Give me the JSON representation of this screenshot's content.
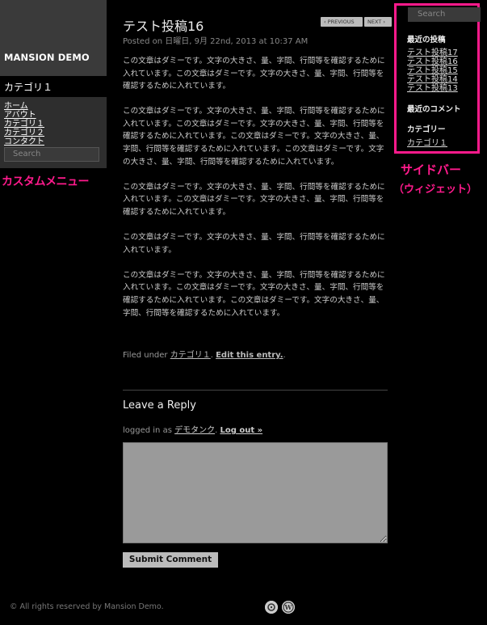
{
  "site": {
    "title": "MANSION DEMO"
  },
  "left": {
    "category_heading": "カテゴリ１",
    "menu": [
      "ホーム",
      "アバウト",
      "カテゴリ１",
      "カテゴリ２",
      "コンタクト"
    ],
    "search_placeholder": "Search",
    "annotation": "カスタムメニュー"
  },
  "post": {
    "title": "テスト投稿16",
    "meta": "Posted on 日曜日, 9月 22nd, 2013 at 10:37 AM",
    "nav": {
      "prev": "‹ PREVIOUS",
      "next": "NEXT ›"
    },
    "paragraphs": [
      "この文章はダミーです。文字の大きさ、量、字間、行間等を確認するために入れています。この文章はダミーです。文字の大きさ、量、字間、行間等を確認するために入れています。",
      "この文章はダミーです。文字の大きさ、量、字間、行間等を確認するために入れています。この文章はダミーです。文字の大きさ、量、字間、行間等を確認するために入れています。この文章はダミーです。文字の大きさ、量、字間、行間等を確認するために入れています。この文章はダミーです。文字の大きさ、量、字間、行間等を確認するために入れています。",
      "この文章はダミーです。文字の大きさ、量、字間、行間等を確認するために入れています。この文章はダミーです。文字の大きさ、量、字間、行間等を確認するために入れています。",
      "この文章はダミーです。文字の大きさ、量、字間、行間等を確認するために入れています。",
      "この文章はダミーです。文字の大きさ、量、字間、行間等を確認するために入れています。この文章はダミーです。文字の大きさ、量、字間、行間等を確認するために入れています。この文章はダミーです。文字の大きさ、量、字間、行間等を確認するために入れています。"
    ],
    "footer": {
      "filed_under": "Filed under ",
      "category": "カテゴリ１",
      "sep": ". ",
      "edit": "Edit this entry.",
      "end": "."
    }
  },
  "reply": {
    "title": "Leave a Reply",
    "logged_in_prefix": "logged in as ",
    "user": "デモタンク",
    "sep": ". ",
    "logout": "Log out »",
    "submit": "Submit Comment"
  },
  "footer": {
    "copyright": "© All rights reserved by Mansion Demo."
  },
  "sidebar": {
    "search_placeholder": "Search",
    "recent_heading": "最近の投稿",
    "recent": [
      "テスト投稿17",
      "テスト投稿16",
      "テスト投稿15",
      "テスト投稿14",
      "テスト投稿13"
    ],
    "comments_heading": "最近のコメント",
    "categories_heading": "カテゴリー",
    "category": "カテゴリ１",
    "annotation_title": "サイドバー",
    "annotation_sub": "（ウィジェット）"
  },
  "colors": {
    "accent": "#ff1a8c",
    "background": "#000000"
  },
  "icons": [
    "feed-icon",
    "wordpress-icon"
  ]
}
